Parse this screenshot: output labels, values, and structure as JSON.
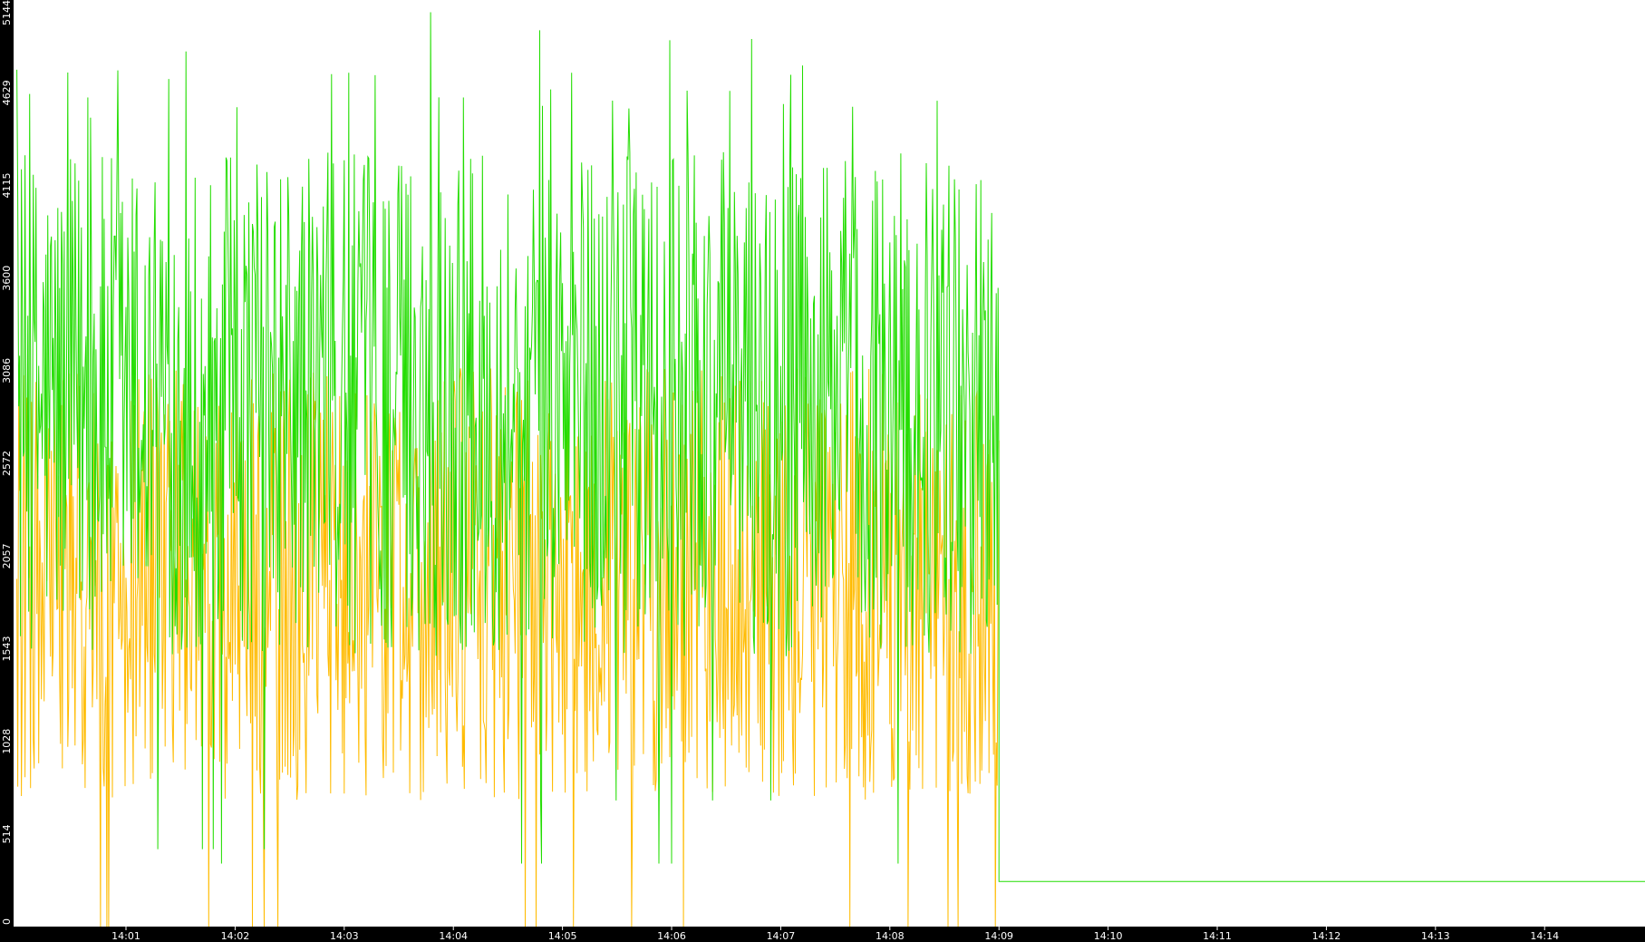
{
  "chart_data": {
    "type": "line",
    "title": "",
    "xlabel": "",
    "ylabel": "",
    "ylim": [
      0,
      5144
    ],
    "yticks": [
      "0",
      "514",
      "1028",
      "1543",
      "2057",
      "2572",
      "3086",
      "3600",
      "4115",
      "4629",
      "5144"
    ],
    "xticks": [
      "14:01",
      "14:02",
      "14:03",
      "14:04",
      "14:05",
      "14:06",
      "14:07",
      "14:08",
      "14:09",
      "14:10",
      "14:11",
      "14:12",
      "14:13",
      "14:14"
    ],
    "x_start_minutes": 839.97,
    "x_end_minutes": 854.92,
    "series": [
      {
        "color": "#22dd00",
        "segments": [
          {
            "from": "14:00",
            "to": "14:09",
            "min": 1500,
            "max": 4300,
            "peaks": [
              4650,
              4820,
              4900,
              5144,
              5080
            ],
            "floor_dips": [
              700,
              430,
              350
            ]
          },
          {
            "from": "14:09",
            "to": "14:14",
            "value": 250
          }
        ]
      },
      {
        "color": "#ffbb00",
        "segments": [
          {
            "from": "14:00",
            "to": "14:09",
            "min": 700,
            "max": 3100,
            "floor_dips": [
              0,
              0,
              0
            ]
          }
        ]
      }
    ],
    "grid": false,
    "legend": "none"
  },
  "colors": {
    "background": "#000000",
    "plot_area": "#ffffff",
    "axis_text": "#ffffff"
  }
}
